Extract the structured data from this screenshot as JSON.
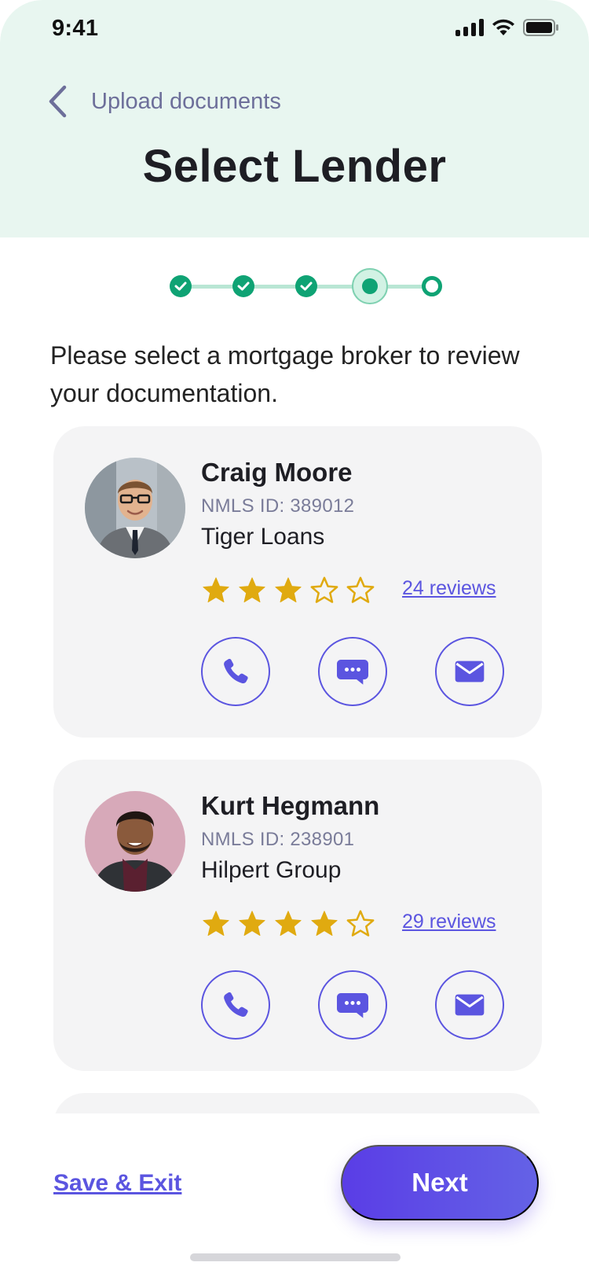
{
  "status_bar": {
    "time": "9:41"
  },
  "header": {
    "back_label": "Upload documents",
    "title": "Select Lender"
  },
  "stepper": {
    "total_steps": 5,
    "completed_steps": 3,
    "current_step": 4
  },
  "intro": "Please select a mortgage broker to review your documentation.",
  "lenders": [
    {
      "name": "Craig Moore",
      "nmls": "NMLS ID: 389012",
      "company": "Tiger Loans",
      "rating": 3,
      "reviews": "24 reviews"
    },
    {
      "name": "Kurt Hegmann",
      "nmls": "NMLS ID: 238901",
      "company": "Hilpert Group",
      "rating": 4,
      "reviews": "29 reviews"
    }
  ],
  "footer": {
    "save_exit": "Save & Exit",
    "next": "Next"
  },
  "colors": {
    "accent": "#5b55e0",
    "success": "#0fa374",
    "star": "#e0aa10",
    "header_bg": "#e8f6f0"
  }
}
